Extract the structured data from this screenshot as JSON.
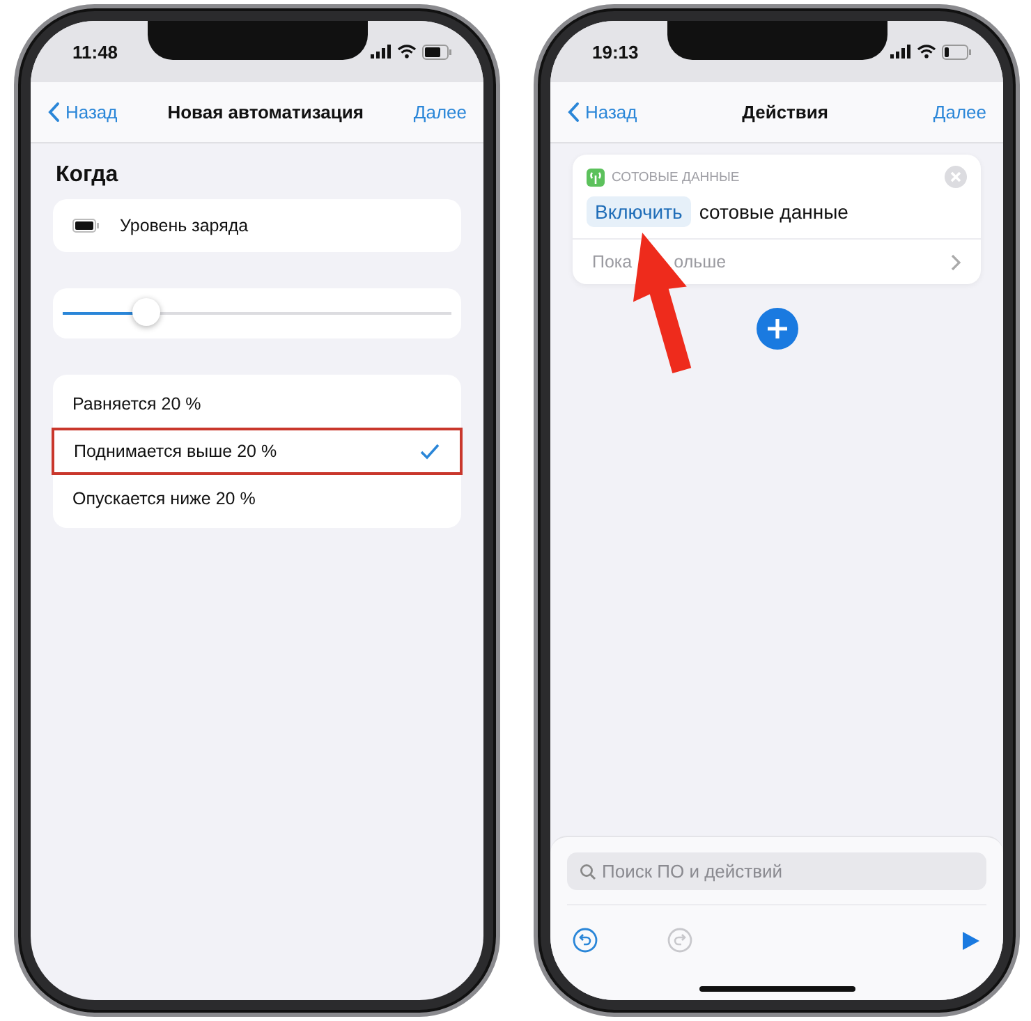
{
  "phones": [
    {
      "kind": "trigger",
      "status_bar": {
        "time": "11:48"
      },
      "nav": {
        "back": "Назад",
        "title": "Новая автоматизация",
        "next": "Далее"
      },
      "section_title": "Когда",
      "trigger": {
        "label": "Уровень заряда"
      },
      "slider": {
        "level": 0.22
      },
      "options": [
        {
          "label": "Равняется 20 %",
          "selected": false
        },
        {
          "label": "Поднимается выше 20 %",
          "selected": true
        },
        {
          "label": "Опускается ниже 20 %",
          "selected": false
        }
      ]
    },
    {
      "kind": "actions",
      "status_bar": {
        "time": "19:13"
      },
      "nav": {
        "back": "Назад",
        "title": "Действия",
        "next": "Далее"
      },
      "action": {
        "category": "СОТОВЫЕ ДАННЫЕ",
        "button": "Включить",
        "text": "сотовые данные",
        "more": [
          "Пока",
          "ольше"
        ]
      },
      "search": {
        "placeholder": "Поиск ПО и действий"
      },
      "toolbar": {
        "undo": {
          "disabled": false
        },
        "redo": {
          "disabled": true
        }
      }
    }
  ]
}
